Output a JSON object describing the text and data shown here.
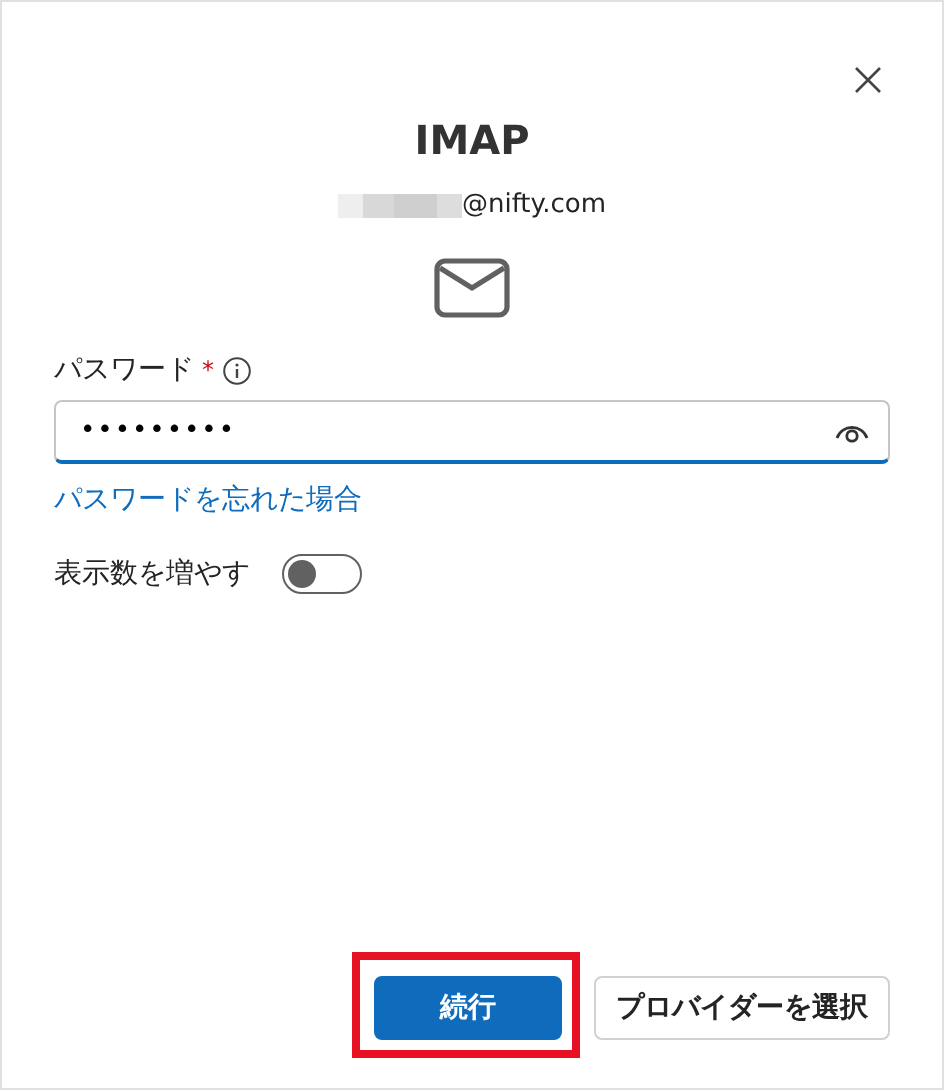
{
  "dialog": {
    "title": "IMAP",
    "account": "@nifty.com"
  },
  "password": {
    "label": "パスワード",
    "required_mark": "*",
    "value": "•••••••••",
    "focused": true
  },
  "forgot_link": "パスワードを忘れた場合",
  "toggle": {
    "label": "表示数を増やす",
    "on": false
  },
  "buttons": [
    {
      "label": "続行",
      "kind": "primary",
      "highlighted": true
    },
    {
      "label": "プロバイダーを選択",
      "kind": "secondary",
      "highlighted": false
    }
  ]
}
